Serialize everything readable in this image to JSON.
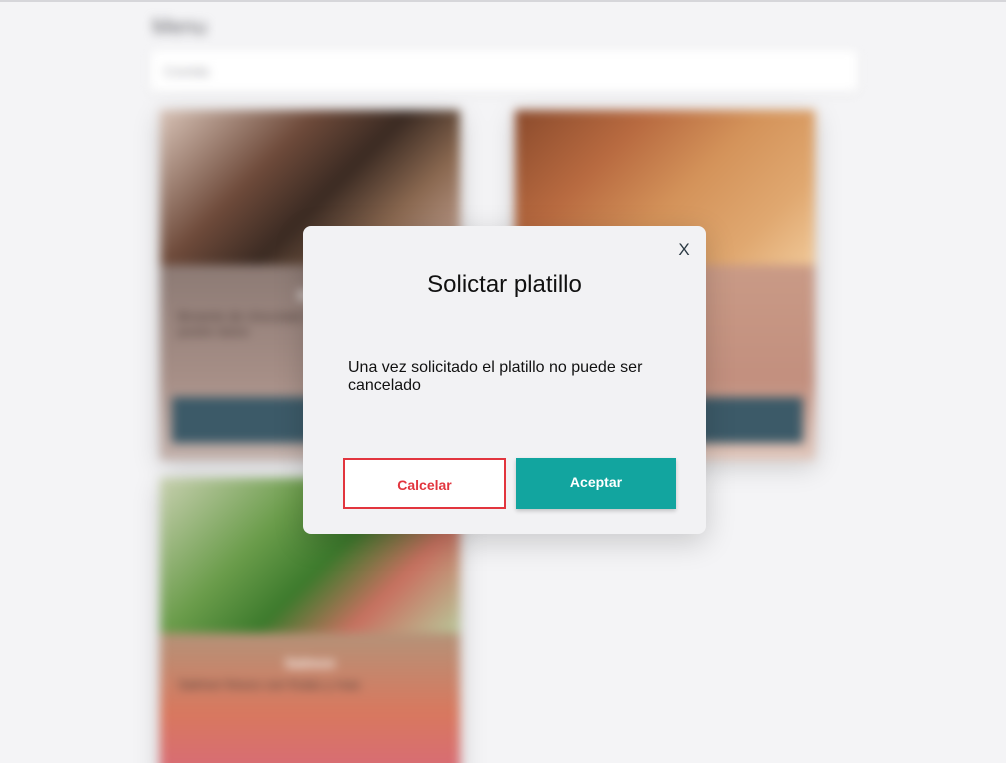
{
  "colors": {
    "page_background": "#f4f4f6",
    "modal_background": "#f2f2f4",
    "cancel_accent": "#e2353e",
    "accept_accent": "#12a59f",
    "card_button": "#3c5a68"
  },
  "background": {
    "title": "Menu",
    "search": {
      "placeholder": "Comida"
    },
    "cards": [
      {
        "name": "Bro",
        "description": "Brownie de chocolate con helado de vainilla postre dulce",
        "image_icon": "brownie-image"
      },
      {
        "name": "",
        "description": "",
        "image_icon": "steak-fries-image"
      },
      {
        "name": "Salmon",
        "description": "Salmon fresco con frutas y mas",
        "image_icon": "salmon-salad-image"
      }
    ]
  },
  "modal": {
    "title": "Solictar platillo",
    "message": "Una vez solicitado el platillo no puede ser cancelado",
    "close_label": "X",
    "cancel_label": "Calcelar",
    "accept_label": "Aceptar"
  }
}
